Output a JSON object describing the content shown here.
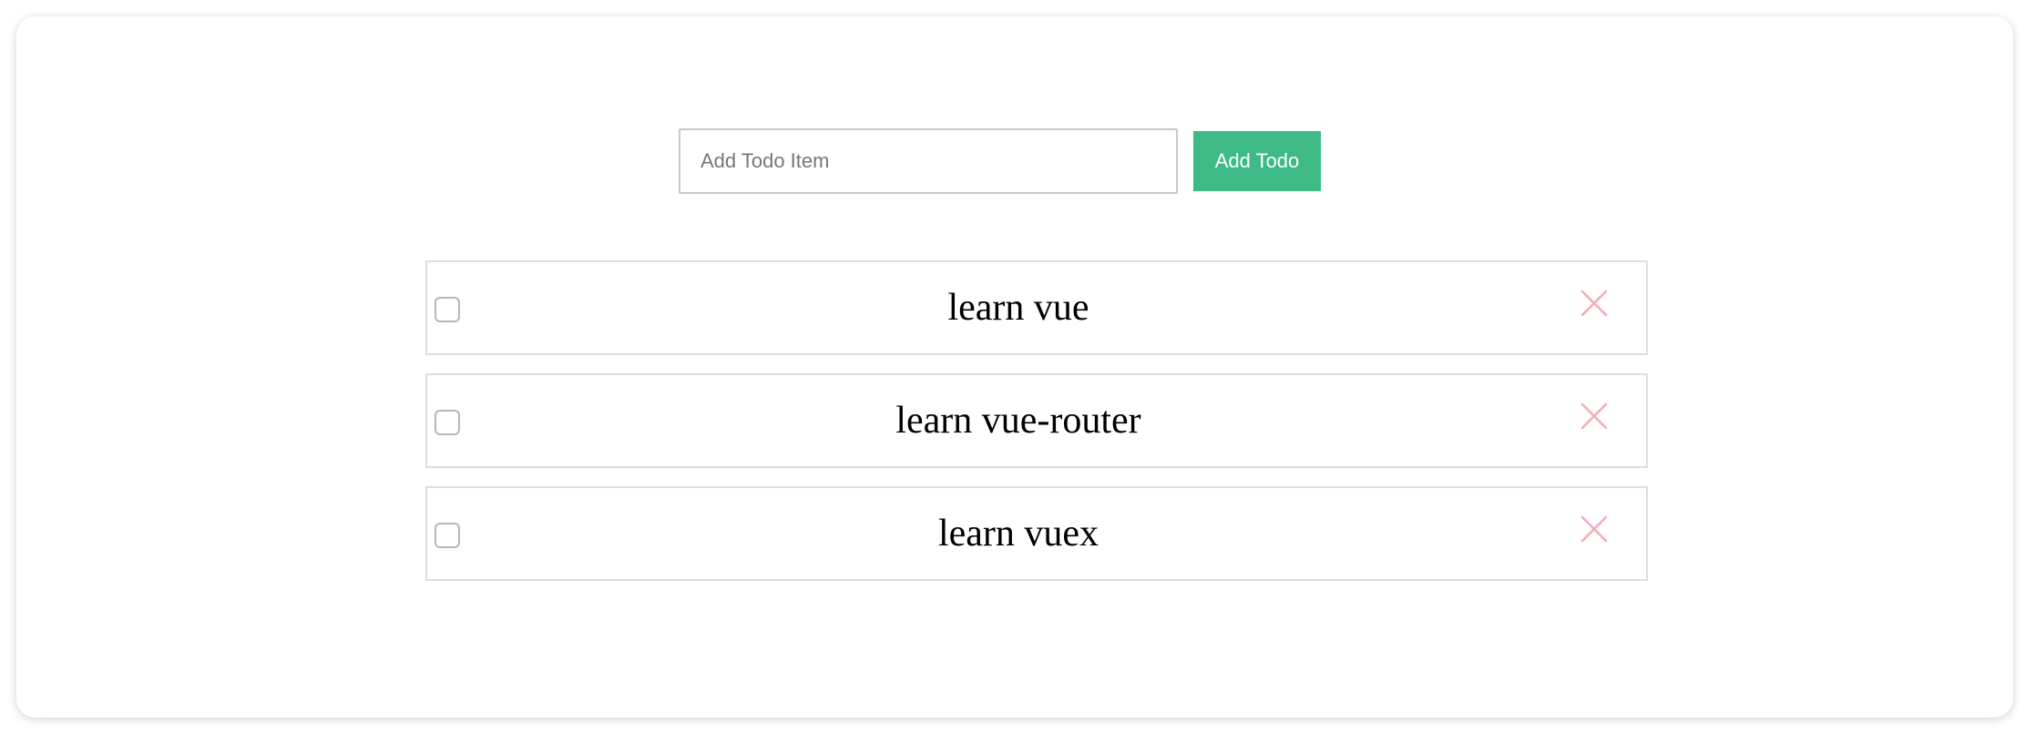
{
  "add_form": {
    "input_value": "",
    "input_placeholder": "Add Todo Item",
    "button_label": "Add Todo"
  },
  "todos": [
    {
      "text": "learn vue",
      "done": false
    },
    {
      "text": "learn vue-router",
      "done": false
    },
    {
      "text": "learn vuex",
      "done": false
    }
  ],
  "icons": {
    "delete": "close-icon",
    "checkbox": "checkbox"
  },
  "colors": {
    "accent": "#3dba85",
    "delete": "#f5aab8",
    "border": "#dedede"
  }
}
